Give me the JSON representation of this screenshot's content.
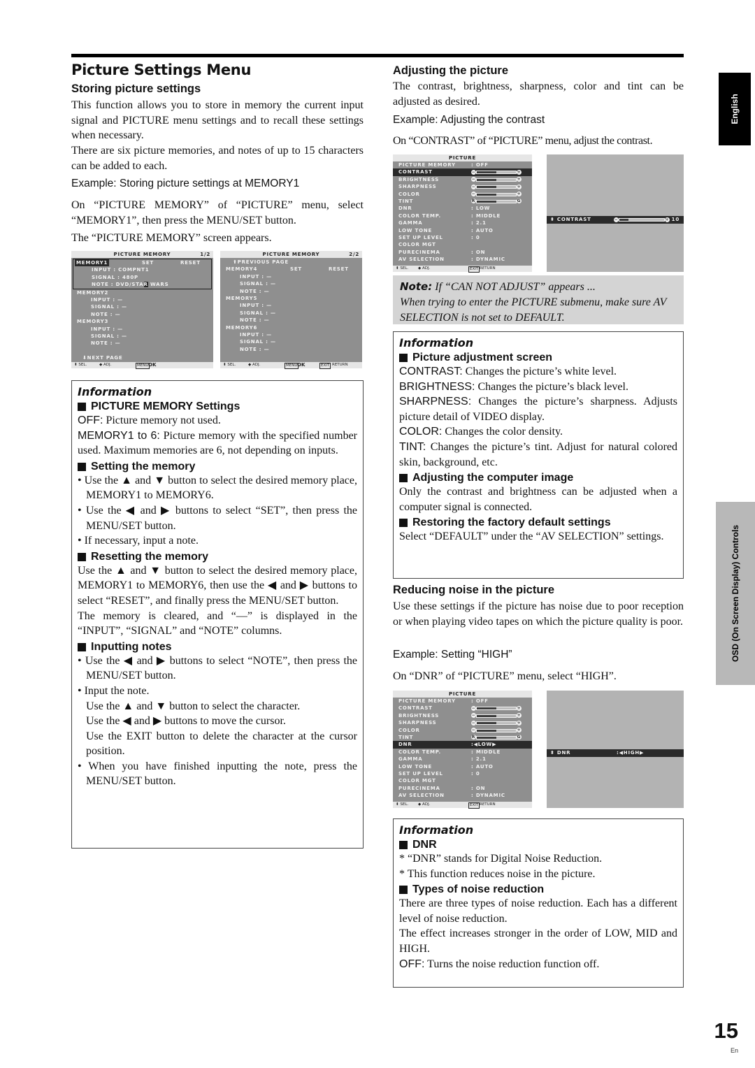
{
  "page": {
    "title": "Picture Settings Menu",
    "page_number": "15",
    "page_lang": "En",
    "side_tabs": {
      "english": "English",
      "section": "OSD (On Screen Display) Controls"
    }
  },
  "storing": {
    "heading": "Storing picture settings",
    "p1": "This function allows you to store in memory the current input signal and PICTURE menu settings and to recall these settings when necessary.",
    "p2": "There are six picture memories, and notes of up to 15 characters can be added to each.",
    "example": "Example: Storing picture settings at MEMORY1",
    "instruction": "On “PICTURE MEMORY” of “PICTURE” menu, select “MEMORY1”, then press the MENU/SET button.",
    "screen_appears": "The “PICTURE MEMORY” screen appears."
  },
  "memory_osd_1": {
    "title": "PICTURE MEMORY",
    "page": "1/2",
    "selected_memory": "MEMORY1",
    "set": "SET",
    "reset": "RESET",
    "memories": [
      {
        "name": "MEMORY1",
        "input": "INPUT : COMPNT1",
        "signal": "SIGNAL : 480P",
        "note_prefix": "NOTE : DVD/STA",
        "note_cursor": "R",
        "note_suffix": " WARS"
      },
      {
        "name": "MEMORY2",
        "input": "INPUT : —",
        "signal": "SIGNAL : —",
        "note": "NOTE : —"
      },
      {
        "name": "MEMORY3",
        "input": "INPUT : —",
        "signal": "SIGNAL : —",
        "note": "NOTE : —"
      }
    ],
    "nav": "⬇NEXT PAGE",
    "footer": {
      "sel": "⬍ SEL.",
      "adj": "◆ ADJ.",
      "menu_key": "MENU",
      "ok": "OK"
    }
  },
  "memory_osd_2": {
    "title": "PICTURE MEMORY",
    "page": "2/2",
    "nav": "⬆PREVIOUS PAGE",
    "set": "SET",
    "reset": "RESET",
    "memories": [
      {
        "name": "MEMORY4",
        "input": "INPUT : —",
        "signal": "SIGNAL : —",
        "note": "NOTE : —"
      },
      {
        "name": "MEMORY5",
        "input": "INPUT : —",
        "signal": "SIGNAL : —",
        "note": "NOTE : —"
      },
      {
        "name": "MEMORY6",
        "input": "INPUT : —",
        "signal": "SIGNAL : —",
        "note": "NOTE : —"
      }
    ],
    "footer": {
      "sel": "⬍ SEL.",
      "adj": "◆ ADJ.",
      "menu_key": "MENU",
      "ok": "OK",
      "exit_key": "EXIT",
      "return": "RETURN"
    }
  },
  "info_memory": {
    "title": "Information",
    "h1": "PICTURE MEMORY Settings",
    "off_term": "OFF:",
    "off_text": " Picture memory not used.",
    "mem_term": "MEMORY1 to 6:",
    "mem_text": " Picture memory with the specified number used. Maximum memories are 6, not depending on inputs.",
    "h2": "Setting the memory",
    "set_b1": "• Use the ▲ and ▼ button to select the desired memory place, MEMORY1 to MEMORY6.",
    "set_b2": "• Use the ◀ and ▶ buttons to select “SET”, then press the MENU/SET button.",
    "set_b3": "• If necessary, input a note.",
    "h3": "Resetting the memory",
    "reset_p1": "Use the ▲ and ▼ button to select the desired memory place, MEMORY1 to MEMORY6, then use the ◀ and ▶ buttons to select “RESET”, and finally press the MENU/SET button.",
    "reset_p2": "The memory is cleared, and “—” is displayed in the “INPUT”, “SIGNAL” and “NOTE” columns.",
    "h4": "Inputting notes",
    "note_b1": "• Use the ◀ and ▶ buttons to select “NOTE”, then press the MENU/SET button.",
    "note_b2": "• Input the note.",
    "note_b2a": "Use the ▲ and ▼ button to select the character.",
    "note_b2b": "Use the ◀ and ▶ buttons to move the cursor.",
    "note_b2c": "Use the EXIT button to delete the character at the cursor position.",
    "note_b3": "• When you have finished inputting the note, press the MENU/SET button."
  },
  "adjusting": {
    "heading": "Adjusting the picture",
    "p1": "The contrast, brightness, sharpness, color and tint can be adjusted as desired.",
    "example": "Example: Adjusting the contrast",
    "instruction": "On “CONTRAST” of “PICTURE” menu, adjust the contrast."
  },
  "picture_osd_contrast": {
    "title": "PICTURE",
    "selected": "CONTRAST",
    "rows": [
      {
        "label": "PICTURE MEMORY",
        "value": ":  OFF"
      },
      {
        "label": "CONTRAST",
        "bar": 0.5
      },
      {
        "label": "BRIGHTNESS",
        "bar": 0.5
      },
      {
        "label": "SHARPNESS",
        "bar": 0.5
      },
      {
        "label": "COLOR",
        "bar": 0.5
      },
      {
        "label": "TINT",
        "bar": 0.5,
        "left": "R",
        "right": "G"
      },
      {
        "label": "DNR",
        "value": ":  LOW"
      },
      {
        "label": "COLOR TEMP.",
        "value": ":  MIDDLE"
      },
      {
        "label": "GAMMA",
        "value": ":  2.1"
      },
      {
        "label": "LOW TONE",
        "value": ":  AUTO"
      },
      {
        "label": "SET UP LEVEL",
        "value": ":  0"
      },
      {
        "label": "COLOR MGT",
        "value": ""
      },
      {
        "label": "PURECINEMA",
        "value": ":  ON"
      },
      {
        "label": "AV SELECTION",
        "value": ":  DYNAMIC"
      }
    ],
    "footer": {
      "sel": "⬍ SEL.",
      "adj": "◆ ADJ.",
      "exit_key": "EXIT",
      "return": "RETURN"
    }
  },
  "contrast_single": {
    "label": "⬍ CONTRAST",
    "value": "10",
    "bar": 0.2
  },
  "note": {
    "label": "Note:",
    "title": " If “CAN NOT ADJUST” appears ...",
    "text": "When trying to enter the PICTURE submenu, make sure AV SELECTION  is not set to DEFAULT."
  },
  "info_adjust": {
    "title": "Information",
    "h1": "Picture adjustment screen",
    "items": [
      {
        "term": "CONTRAST:",
        "text": " Changes the picture’s white level."
      },
      {
        "term": "BRIGHTNESS:",
        "text": " Changes the picture’s black level."
      },
      {
        "term": "SHARPNESS:",
        "text": " Changes the picture’s sharpness. Adjusts picture detail of VIDEO display."
      },
      {
        "term": "COLOR:",
        "text": " Changes the color density."
      },
      {
        "term": "TINT:",
        "text": " Changes the picture’s tint. Adjust for natural colored skin, background, etc."
      }
    ],
    "h2": "Adjusting the computer image",
    "p2": "Only the contrast and brightness can be adjusted when a computer signal is connected.",
    "h3": "Restoring the factory default settings",
    "p3": "Select “DEFAULT” under the “AV SELECTION” settings."
  },
  "noise": {
    "heading": "Reducing noise in the picture",
    "p1": "Use these settings if the picture has noise due to poor reception or when playing video tapes on which the picture quality is poor.",
    "example": "Example: Setting “HIGH”",
    "instruction": "On “DNR” of “PICTURE” menu, select “HIGH”."
  },
  "picture_osd_dnr": {
    "title": "PICTURE",
    "selected": "DNR",
    "dnr_value": ":◀LOW▶",
    "footer": {
      "sel": "⬍ SEL.",
      "adj": "◆ ADJ.",
      "exit_key": "EXIT",
      "return": "RETURN"
    }
  },
  "dnr_single": {
    "label": "⬍ DNR",
    "value": ":◀HIGH▶"
  },
  "info_dnr": {
    "title": "Information",
    "h1": "DNR",
    "l1": "* “DNR” stands for Digital Noise Reduction.",
    "l2": "* This function reduces noise in the picture.",
    "h2": "Types of noise reduction",
    "p1": "There are three types of noise reduction. Each has a different level of noise reduction.",
    "p2": "The effect increases stronger in the order of LOW, MID and HIGH.",
    "off_term": "OFF:",
    "off_text": " Turns the noise reduction function off."
  }
}
